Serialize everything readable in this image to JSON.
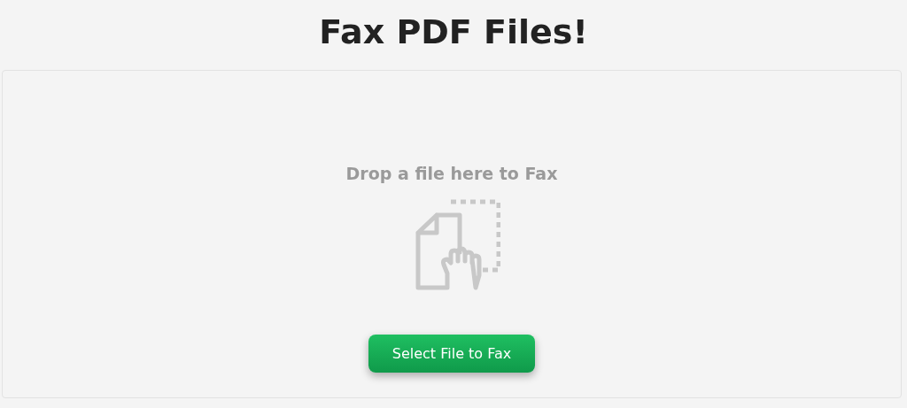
{
  "title": "Fax PDF Files!",
  "dropzone": {
    "prompt": "Drop a file here to Fax",
    "button": "Select File to Fax"
  }
}
